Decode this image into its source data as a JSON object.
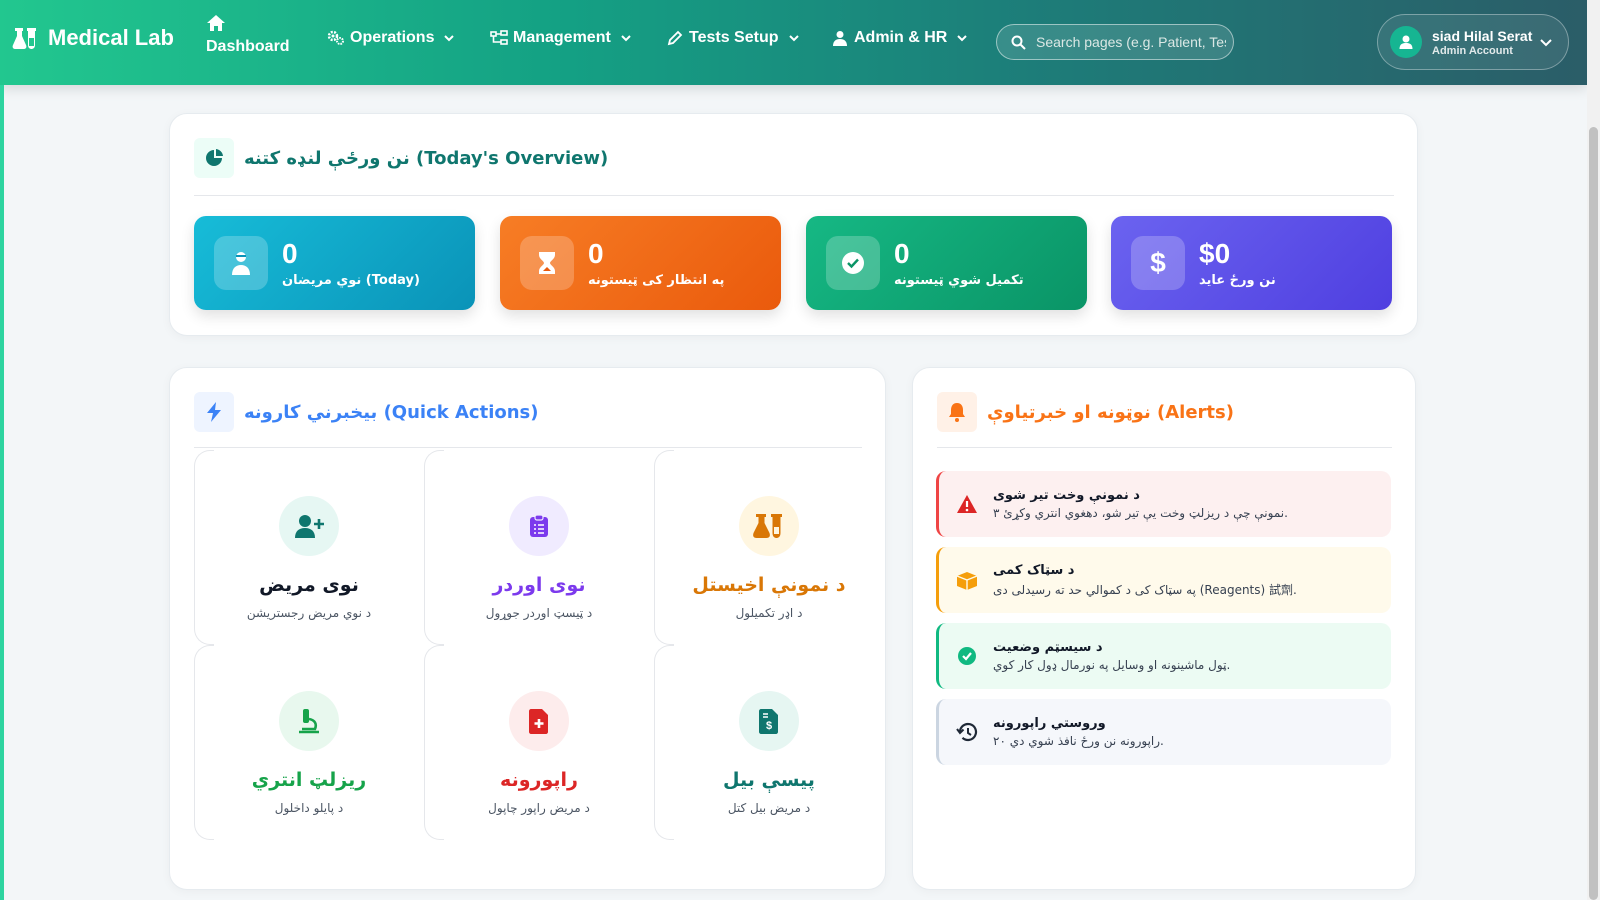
{
  "brand": {
    "name": "Medical Lab"
  },
  "nav": {
    "dashboard": "Dashboard",
    "operations": "Operations",
    "management": "Management",
    "tests_setup": "Tests Setup",
    "admin_hr": "Admin & HR"
  },
  "search": {
    "placeholder": "Search pages (e.g. Patient, Test)"
  },
  "user": {
    "name": "siad Hilal Serat",
    "role": "Admin Account"
  },
  "overview": {
    "title": "نن ورځې لنډه کتنه (Today's Overview)",
    "stats": [
      {
        "value": "0",
        "label": "نوي مريضان (Today)",
        "icon": "user-doctor-icon",
        "color": "#0ea5c6"
      },
      {
        "value": "0",
        "label": "په انتظار کی ټیستونه",
        "icon": "hourglass-icon",
        "color": "#f26a16"
      },
      {
        "value": "0",
        "label": "تکمیل شوي ټیستونه",
        "icon": "check-circle-icon",
        "color": "#10a871"
      },
      {
        "value": "$0",
        "label": "نن ورځ عاید",
        "icon": "dollar-icon",
        "color": "#5b4ee8"
      }
    ]
  },
  "quick": {
    "title": "بیخبرني کارونه (Quick Actions)",
    "actions": [
      {
        "title": "نوی مریض",
        "sub": "د نوي مريض رجستريشن",
        "icon": "user-plus-icon",
        "color": "#111827"
      },
      {
        "title": "نوی اوردر",
        "sub": "د ټیسټ اوردر جوړول",
        "icon": "clipboard-list-icon",
        "color": "#7c3aed"
      },
      {
        "title": "د نمونې اخیستل",
        "sub": "د اډر تکمیلول",
        "icon": "flask-icon",
        "color": "#d97706"
      },
      {
        "title": "ریزلټ انتري",
        "sub": "د پایلو داخلول",
        "icon": "microscope-icon",
        "color": "#16a34a"
      },
      {
        "title": "راپورونه",
        "sub": "د مریض راپور چاپول",
        "icon": "file-medical-icon",
        "color": "#dc2626"
      },
      {
        "title": "پیسې بیل",
        "sub": "د مریض بیل کتل",
        "icon": "file-invoice-dollar-icon",
        "color": "#0f766e"
      }
    ]
  },
  "alerts": {
    "title": "نوټونه او خبرتیاوې (Alerts)",
    "items": [
      {
        "title": "د نمونې وخت تیر شوی",
        "desc": "نمونې چې د ریزلټ وخت یې تیر شو، دهغوي انتري وکړئ ۳.",
        "icon": "warning-icon"
      },
      {
        "title": "د سټاک کمی",
        "desc": "په سټاک کی د کموالي حد ته رسیدلی دی (Reagents) 試劑.",
        "icon": "boxes-icon"
      },
      {
        "title": "د سیسټم وضعیت",
        "desc": "ټول ماشینونه او وسایل په نورمال ډول کار کوي.",
        "icon": "check-circle-icon"
      },
      {
        "title": "وروستي راپورونه",
        "desc": "راپورونه نن ورځ نافذ شوي دي ۲۰.",
        "icon": "history-icon"
      }
    ]
  }
}
